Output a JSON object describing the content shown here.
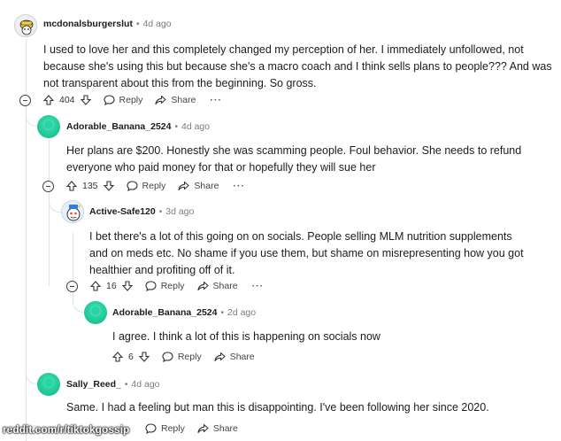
{
  "comments": [
    {
      "username": "mcdonalsburgerslut",
      "age": "4d ago",
      "text": "I used to love her and this completely changed my perception of her. I immediately unfollowed, not because she's using this but because she's a macro coach and I think sells plans to people??? And was not transparent about this from the beginning. So gross.",
      "score": "404",
      "reply_label": "Reply",
      "share_label": "Share"
    },
    {
      "username": "Adorable_Banana_2524",
      "age": "4d ago",
      "text": "Her plans are $200. Honestly she was scamming people. Foul behavior. She needs to refund everyone who paid money for that or hopefully they will sue her",
      "score": "135",
      "reply_label": "Reply",
      "share_label": "Share"
    },
    {
      "username": "Active-Safe120",
      "age": "3d ago",
      "text": "I bet there's a lot of this going on on socials. People selling MLM nutrition supplements and on meds etc. No shame if you use them, but shame on misrepresenting how you got healthier and profiting off of it.",
      "score": "16",
      "reply_label": "Reply",
      "share_label": "Share"
    },
    {
      "username": "Adorable_Banana_2524",
      "age": "2d ago",
      "text": "I agree. I think a lot of this is happening on socials now",
      "score": "6",
      "reply_label": "Reply",
      "share_label": "Share"
    },
    {
      "username": "Sally_Reed_",
      "age": "4d ago",
      "text": "Same. I had a feeling but man this is disappointing. I've been following her since 2020.",
      "score": "",
      "reply_label": "Reply",
      "share_label": "Share"
    }
  ],
  "separator": "•",
  "watermark": "reddit.com/r/tiktokgossip",
  "icons": {
    "upvote": "upvote-arrow-icon",
    "downvote": "downvote-arrow-icon",
    "reply": "speech-bubble-icon",
    "share": "share-arrow-icon",
    "more": "ellipsis-icon",
    "collapse": "collapse-minus-icon"
  },
  "colors": {
    "avatar_green": "#1fc99a",
    "thread_line": "#e0e4e7",
    "meta_text": "#7c7c7c"
  }
}
